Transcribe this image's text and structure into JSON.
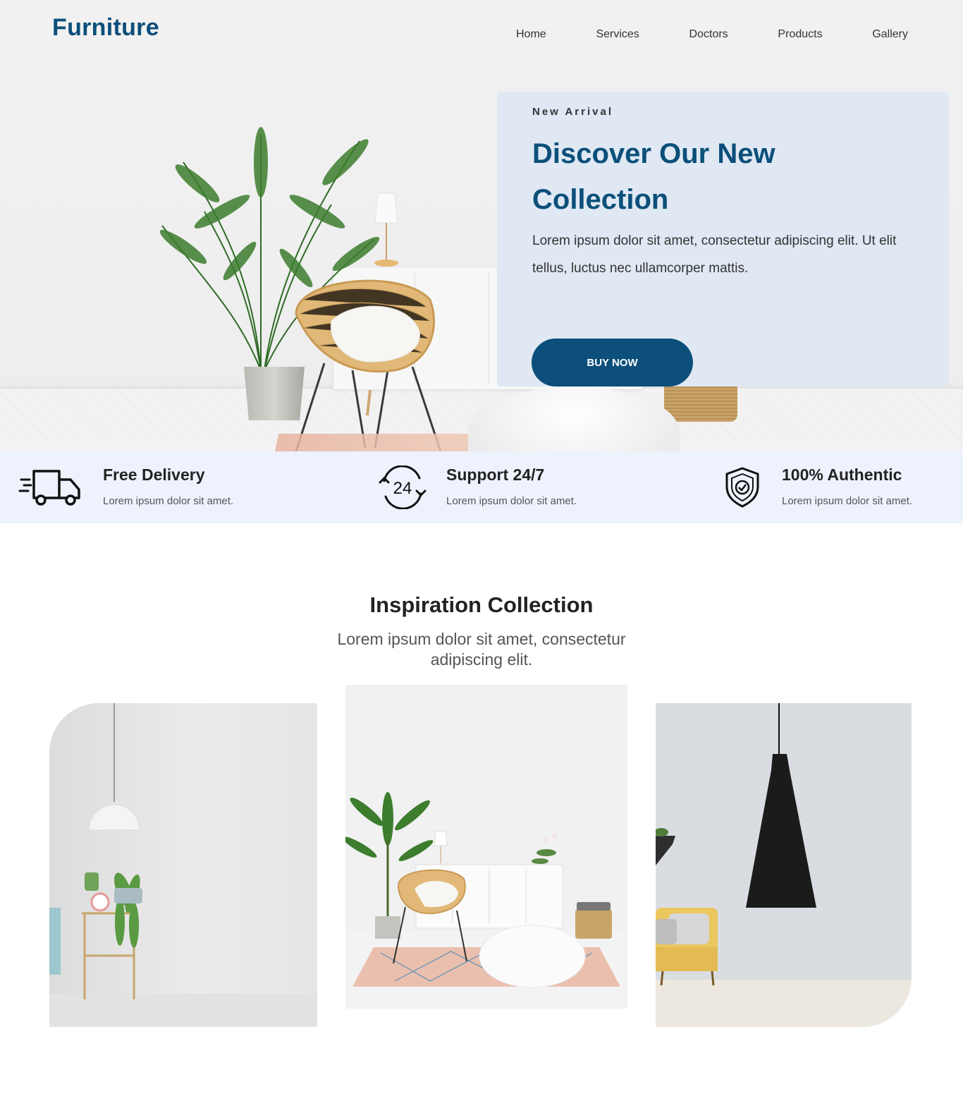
{
  "brand": {
    "logo": "Furniture",
    "accent_color": "#0b4f7a"
  },
  "nav": {
    "items": [
      "Home",
      "Services",
      "Doctors",
      "Products",
      "Gallery"
    ]
  },
  "hero": {
    "eyebrow": "New Arrival",
    "title": "Discover Our New Collection",
    "text": "Lorem ipsum dolor sit amet, consectetur adipiscing elit. Ut elit tellus, luctus nec ullamcorper mattis.",
    "button_label": "BUY NOW",
    "card_color": "#dfe8f3"
  },
  "features": [
    {
      "icon": "delivery-truck-icon",
      "title": "Free Delivery",
      "desc": "Lorem ipsum dolor sit amet."
    },
    {
      "icon": "support-24-icon",
      "title": "Support 24/7",
      "desc": "Lorem ipsum dolor sit amet."
    },
    {
      "icon": "shield-check-icon",
      "title": "100% Authentic",
      "desc": "Lorem ipsum dolor sit amet."
    }
  ],
  "inspiration": {
    "title": "Inspiration Collection",
    "subtitle": "Lorem ipsum dolor sit amet, consectetur adipiscing elit."
  }
}
